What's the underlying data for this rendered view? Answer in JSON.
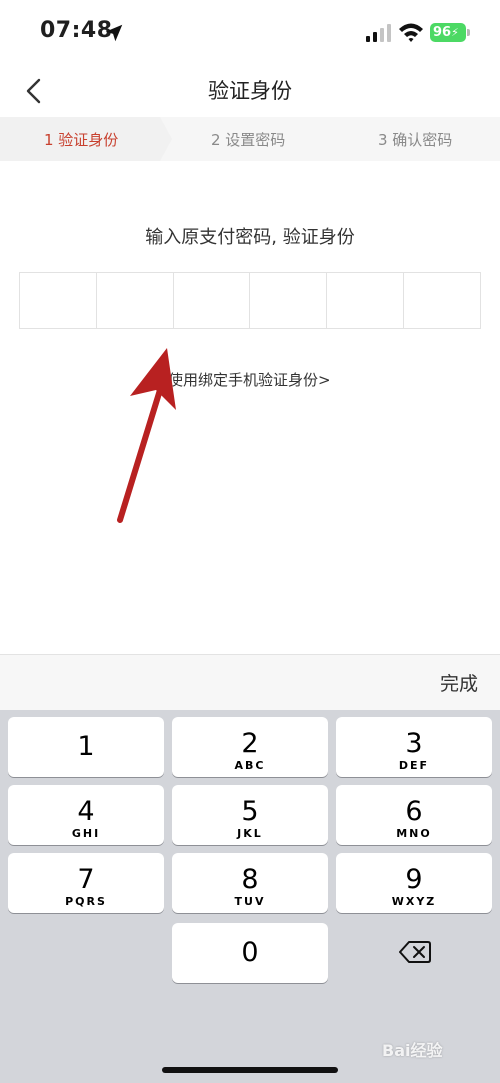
{
  "status_bar": {
    "time": "07:48",
    "battery": "96"
  },
  "nav": {
    "title": "验证身份",
    "back_icon": "chevron-left-icon"
  },
  "steps": [
    {
      "label": "1 验证身份",
      "active": true
    },
    {
      "label": "2 设置密码",
      "active": false
    },
    {
      "label": "3 确认密码",
      "active": false
    }
  ],
  "content": {
    "prompt": "输入原支付密码, 验证身份",
    "pin_length": 6,
    "alt_link": "使用绑定手机验证身份>"
  },
  "keyboard": {
    "done_label": "完成",
    "keys": [
      {
        "digit": "1",
        "letters": ""
      },
      {
        "digit": "2",
        "letters": "ABC"
      },
      {
        "digit": "3",
        "letters": "DEF"
      },
      {
        "digit": "4",
        "letters": "GHI"
      },
      {
        "digit": "5",
        "letters": "JKL"
      },
      {
        "digit": "6",
        "letters": "MNO"
      },
      {
        "digit": "7",
        "letters": "PQRS"
      },
      {
        "digit": "8",
        "letters": "TUV"
      },
      {
        "digit": "9",
        "letters": "WXYZ"
      },
      {
        "digit": "0",
        "letters": ""
      }
    ],
    "delete_icon": "backspace-icon"
  },
  "watermark": "Bai经验",
  "colors": {
    "accent": "#c8402e",
    "battery": "#4cd964",
    "annotation_arrow": "#b82121"
  }
}
